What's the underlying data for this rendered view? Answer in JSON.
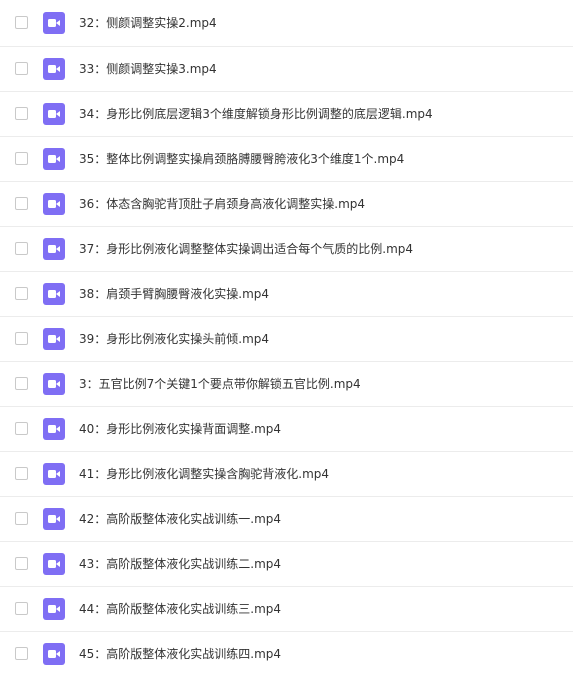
{
  "files": [
    {
      "name": "32：侧颜调整实操2.mp4",
      "icon": "video-file-icon"
    },
    {
      "name": "33：侧颜调整实操3.mp4",
      "icon": "video-file-icon"
    },
    {
      "name": "34：身形比例底层逻辑3个维度解锁身形比例调整的底层逻辑.mp4",
      "icon": "video-file-icon"
    },
    {
      "name": "35：整体比例调整实操肩颈胳膊腰臀胯液化3个维度1个.mp4",
      "icon": "video-file-icon"
    },
    {
      "name": "36：体态含胸驼背顶肚子肩颈身高液化调整实操.mp4",
      "icon": "video-file-icon"
    },
    {
      "name": "37：身形比例液化调整整体实操调出适合每个气质的比例.mp4",
      "icon": "video-file-icon"
    },
    {
      "name": "38：肩颈手臂胸腰臀液化实操.mp4",
      "icon": "video-file-icon"
    },
    {
      "name": "39：身形比例液化实操头前倾.mp4",
      "icon": "video-file-icon"
    },
    {
      "name": "3：五官比例7个关键1个要点带你解锁五官比例.mp4",
      "icon": "video-file-icon"
    },
    {
      "name": "40：身形比例液化实操背面调整.mp4",
      "icon": "video-file-icon"
    },
    {
      "name": "41：身形比例液化调整实操含胸驼背液化.mp4",
      "icon": "video-file-icon"
    },
    {
      "name": "42：高阶版整体液化实战训练一.mp4",
      "icon": "video-file-icon"
    },
    {
      "name": "43：高阶版整体液化实战训练二.mp4",
      "icon": "video-file-icon"
    },
    {
      "name": "44：高阶版整体液化实战训练三.mp4",
      "icon": "video-file-icon"
    },
    {
      "name": "45：高阶版整体液化实战训练四.mp4",
      "icon": "video-file-icon"
    }
  ],
  "colors": {
    "icon_bg": "#7f6ef4",
    "text": "#333333",
    "divider": "#ececec",
    "checkbox_border": "#c9c9c9"
  }
}
